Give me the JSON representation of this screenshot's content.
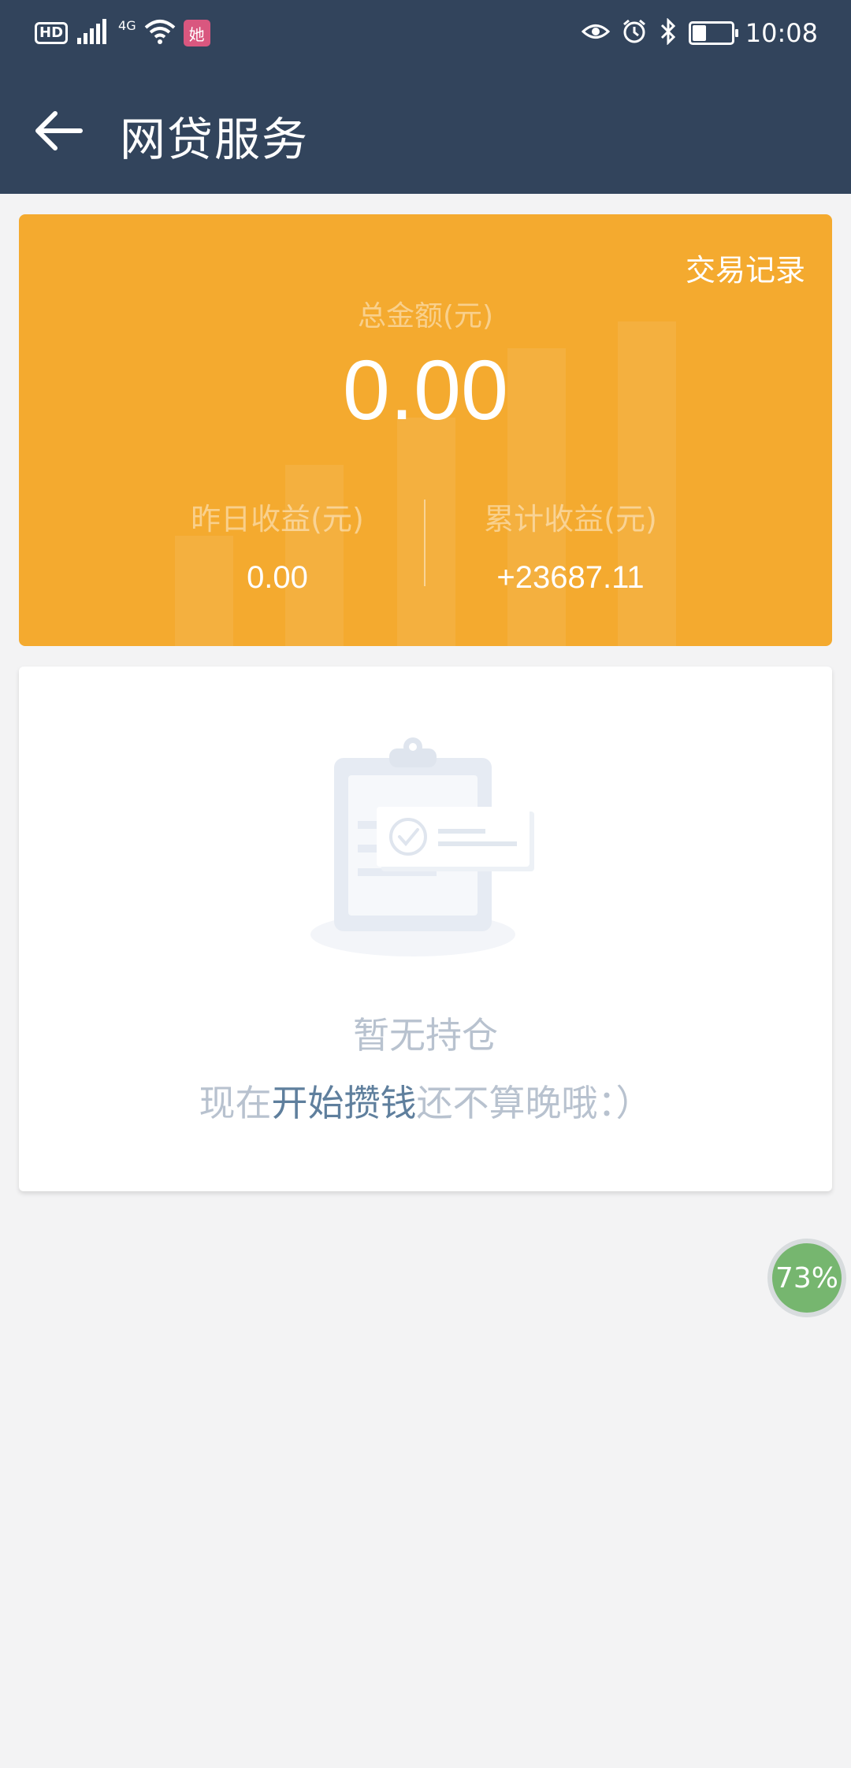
{
  "status_bar": {
    "left_icons": [
      "hd-icon",
      "4g-signal-icon",
      "wifi-icon",
      "app-notification-icon"
    ],
    "hd_label": "HD",
    "network_label": "4G",
    "app_badge": "她",
    "right_icons": [
      "eye-icon",
      "alarm-icon",
      "bluetooth-icon",
      "battery-icon"
    ],
    "battery_level": 0.35,
    "time": "10:08"
  },
  "header": {
    "back_icon": "back-arrow-icon",
    "title": "网贷服务"
  },
  "summary": {
    "records_link": "交易记录",
    "total_label": "总金额(元)",
    "total_value": "0.00",
    "yesterday_label": "昨日收益(元)",
    "yesterday_value": "0.00",
    "cumulative_label": "累计收益(元)",
    "cumulative_value": "+23687.11",
    "background_color": "#f4aa2f"
  },
  "empty_state": {
    "illustration": "clipboard-check-icon",
    "title": "暂无持仓",
    "subtitle_prefix": "现在",
    "subtitle_link": "开始攒钱",
    "subtitle_suffix": "还不算晚哦：）"
  },
  "floating_bubble": {
    "percent": "73%",
    "color": "#76b66f"
  },
  "colors": {
    "header_bg": "#32445c",
    "page_bg": "#f3f3f4",
    "link": "#5f7f9d"
  }
}
